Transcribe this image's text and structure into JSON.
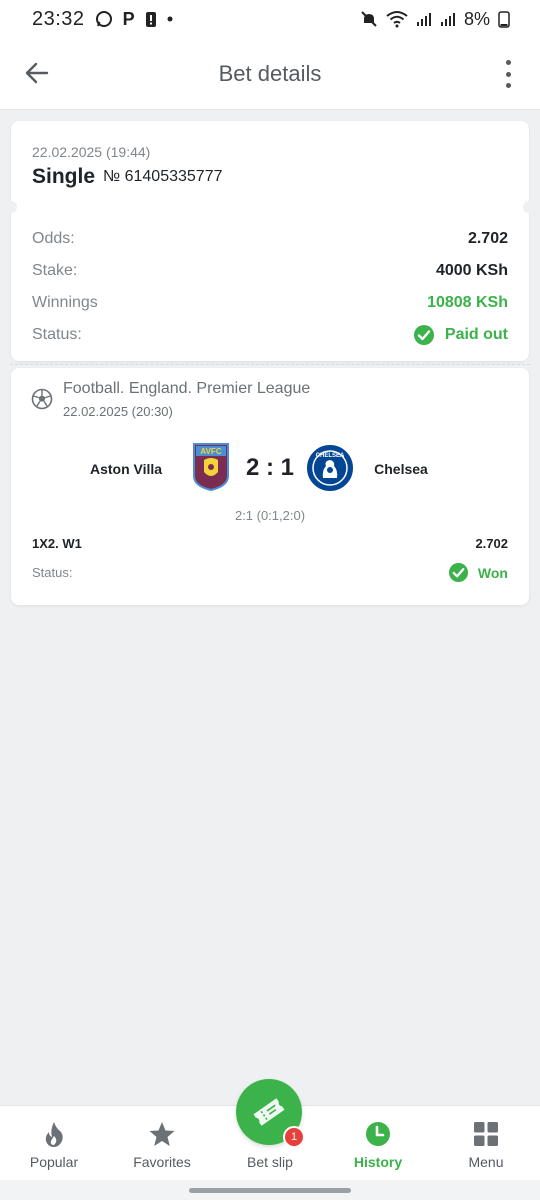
{
  "status_bar": {
    "time": "23:32",
    "battery": "8%"
  },
  "header": {
    "title": "Bet details"
  },
  "bet": {
    "date": "22.02.2025 (19:44)",
    "type": "Single",
    "number": "№ 61405335777",
    "rows": [
      {
        "label": "Odds:",
        "value": "2.702"
      },
      {
        "label": "Stake:",
        "value": "4000 KSh"
      },
      {
        "label": "Winnings",
        "value": "10808 KSh"
      },
      {
        "label": "Status:",
        "value": "Paid out"
      }
    ]
  },
  "event": {
    "league": "Football. England. Premier League",
    "date": "22.02.2025 (20:30)",
    "home_team": "Aston Villa",
    "away_team": "Chelsea",
    "home_crest_text": "AVFC",
    "away_crest_text": "CHELSEA",
    "score": "2 : 1",
    "score_detail": "2:1 (0:1,2:0)",
    "pick": "1X2. W1",
    "pick_odds": "2.702",
    "status_label": "Status:",
    "status_value": "Won"
  },
  "bottom_nav": {
    "items": [
      {
        "label": "Popular",
        "icon": "flame-icon"
      },
      {
        "label": "Favorites",
        "icon": "star-icon"
      },
      {
        "label": "Bet slip",
        "icon": "ticket-icon"
      },
      {
        "label": "History",
        "icon": "clock-icon"
      },
      {
        "label": "Menu",
        "icon": "grid-icon"
      }
    ],
    "active": "History",
    "betslip_badge": "1"
  },
  "colors": {
    "accent_green": "#3bb24a",
    "badge_red": "#e5403b",
    "background": "#eef0f2"
  }
}
